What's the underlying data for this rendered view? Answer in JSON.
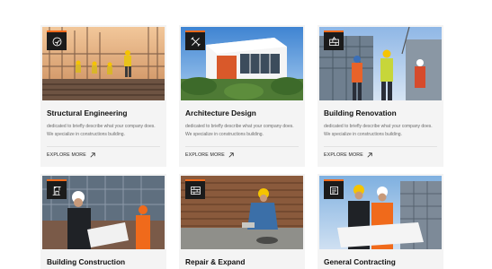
{
  "colors": {
    "accent": "#f06a1b",
    "badge_bg": "#1b1b1b",
    "card_bg": "#f4f4f4"
  },
  "services": [
    {
      "title": "Structural Engineering",
      "desc_line1": "dedicated to briefly describe what your company does.",
      "desc_line2": "We specialize in constructions building.",
      "cta": "EXPLORE MORE",
      "icon": "drill-icon"
    },
    {
      "title": "Architecture Design",
      "desc_line1": "dedicated to briefly describe what your company does.",
      "desc_line2": "We specialize in constructions building.",
      "cta": "EXPLORE MORE",
      "icon": "tools-icon"
    },
    {
      "title": "Building Renovation",
      "desc_line1": "dedicated to briefly describe what your company does.",
      "desc_line2": "We specialize in constructions building.",
      "cta": "EXPLORE MORE",
      "icon": "bricks-icon"
    },
    {
      "title": "Building Construction",
      "icon": "crane-icon"
    },
    {
      "title": "Repair & Expand",
      "icon": "wall-icon"
    },
    {
      "title": "General Contracting",
      "icon": "blueprint-icon"
    }
  ]
}
